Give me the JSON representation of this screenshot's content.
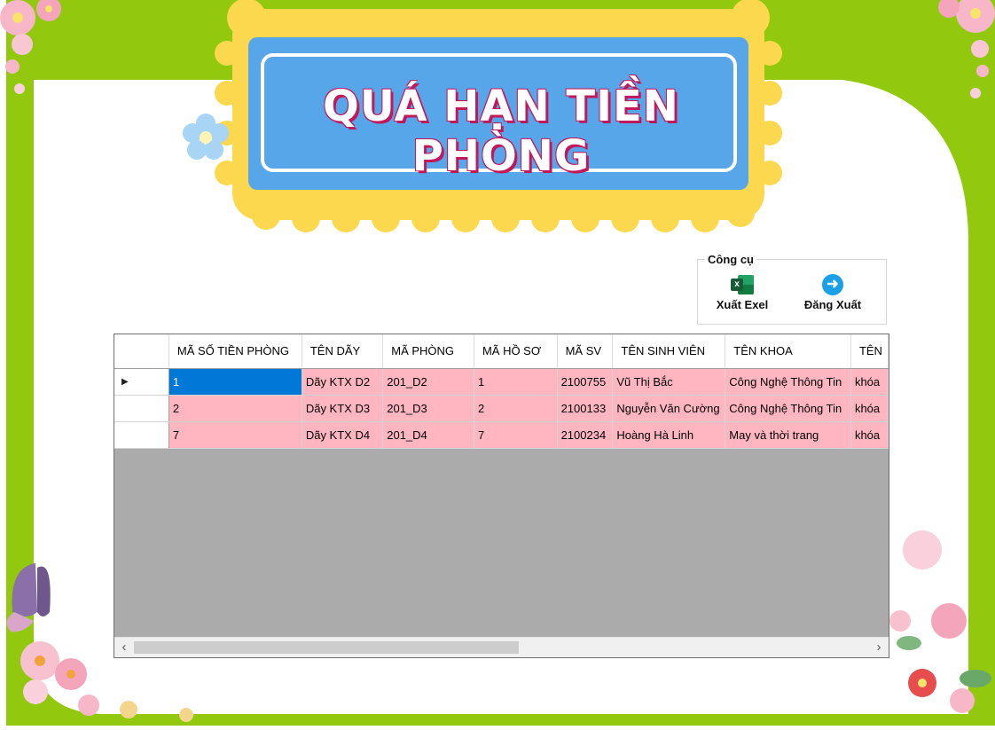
{
  "title": "QUÁ HẠN TIỀN PHÒNG",
  "toolbox": {
    "title": "Công cụ",
    "export_excel": "Xuất Exel",
    "logout": "Đăng Xuất"
  },
  "grid": {
    "columns": [
      "MÃ SỐ TIỀN PHÒNG",
      "TÊN DÃY",
      "MÃ PHÒNG",
      "MÃ HỒ SƠ",
      "MÃ SV",
      "TÊN SINH VIÊN",
      "TÊN KHOA",
      "TÊN"
    ],
    "rows": [
      [
        "1",
        "Dãy KTX D2",
        "201_D2",
        "1",
        "2100755",
        "Vũ Thị Bắc",
        "Công Nghệ Thông Tin",
        "khóa"
      ],
      [
        "2",
        "Dãy KTX D3",
        "201_D3",
        "2",
        "2100133",
        "Nguyễn Văn Cường",
        "Công Nghệ Thông Tin",
        "khóa"
      ],
      [
        "7",
        "Dãy KTX D4",
        "201_D4",
        "7",
        "2100234",
        "Hoàng Hà Linh",
        "May và thời trang",
        "khóa"
      ]
    ],
    "current_row_marker": "▶",
    "selected_cell_color": "#0078d7",
    "row_color": "#ffb6c1"
  },
  "colors": {
    "frame_green": "#92c90f",
    "title_plate": "#58a6ea",
    "title_wave": "#fbd84e"
  }
}
